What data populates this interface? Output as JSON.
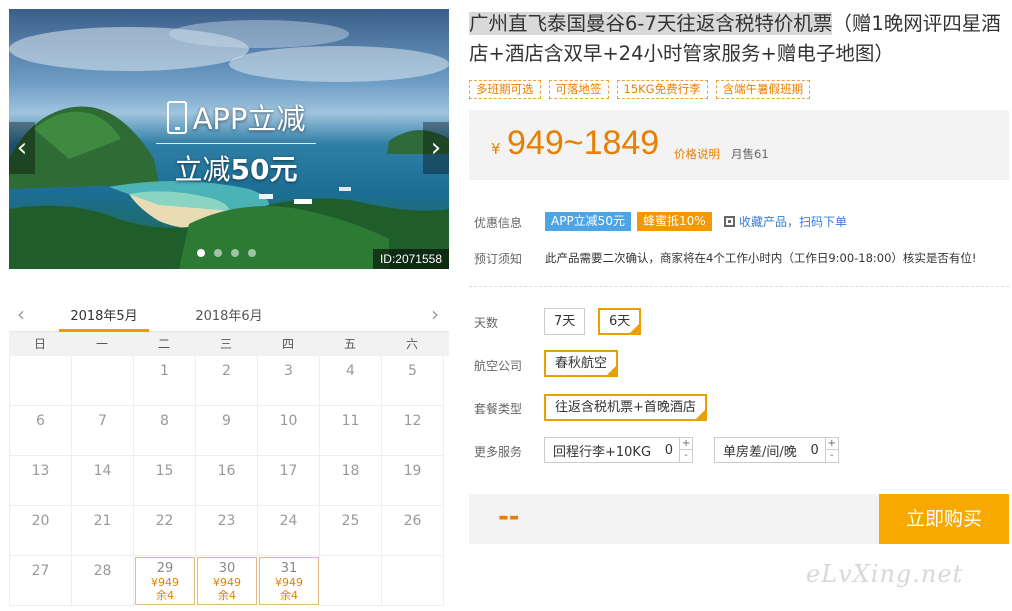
{
  "hero": {
    "promo_top": "APP立减",
    "promo_bottom_prefix": "立减",
    "promo_bottom_amount": "50元",
    "id_label": "ID:2071558",
    "prev_arrow": "‹",
    "next_arrow": "›"
  },
  "product": {
    "title_highlight": "广州直飞泰国曼谷6-7天往返含税特价机票",
    "title_rest": "（赠1晚网评四星酒店+酒店含双早+24小时管家服务+赠电子地图）",
    "tags": [
      "多班期可选",
      "可落地签",
      "15KG免费行李",
      "含端午暑假班期"
    ],
    "currency": "¥",
    "price_range": "949~1849",
    "price_note": "价格说明",
    "sold": "月售61"
  },
  "offers": {
    "label": "优惠信息",
    "app_badge": "APP立减50元",
    "honey_badge": "蜂蜜抵10%",
    "qr_text": "收藏产品，扫码下单"
  },
  "booking_notice": {
    "label": "预订须知",
    "text": "此产品需要二次确认，商家将在4个工作小时内（工作日9:00-18:00）核实是否有位!"
  },
  "options": {
    "days_label": "天数",
    "day_opt1": "7天",
    "day_opt2": "6天",
    "airline_label": "航空公司",
    "airline": "春秋航空",
    "package_label": "套餐类型",
    "package": "往返含税机票+首晚酒店",
    "services_label": "更多服务",
    "service1": "回程行李+10KG",
    "service1_qty": "0",
    "service2": "单房差/间/晚",
    "service2_qty": "0",
    "plus": "+",
    "minus": "-"
  },
  "buy": {
    "total": "--",
    "button": "立即购买"
  },
  "calendar": {
    "prev": "‹",
    "next": "›",
    "tab_current": "2018年5月",
    "tab_next": "2018年6月",
    "weekdays": [
      "日",
      "一",
      "二",
      "三",
      "四",
      "五",
      "六"
    ],
    "row1": [
      "",
      "",
      "1",
      "2",
      "3",
      "4",
      "5"
    ],
    "row2": [
      "6",
      "7",
      "8",
      "9",
      "10",
      "11",
      "12"
    ],
    "row3": [
      "13",
      "14",
      "15",
      "16",
      "17",
      "18",
      "19"
    ],
    "row4": [
      "20",
      "21",
      "22",
      "23",
      "24",
      "25",
      "26"
    ],
    "row5": [
      "27",
      "28"
    ],
    "avail": [
      {
        "day": "29",
        "price": "¥949",
        "stock": "余4"
      },
      {
        "day": "30",
        "price": "¥949",
        "stock": "余4"
      },
      {
        "day": "31",
        "price": "¥949",
        "stock": "余4"
      }
    ]
  },
  "watermark": "eLvXing.net"
}
